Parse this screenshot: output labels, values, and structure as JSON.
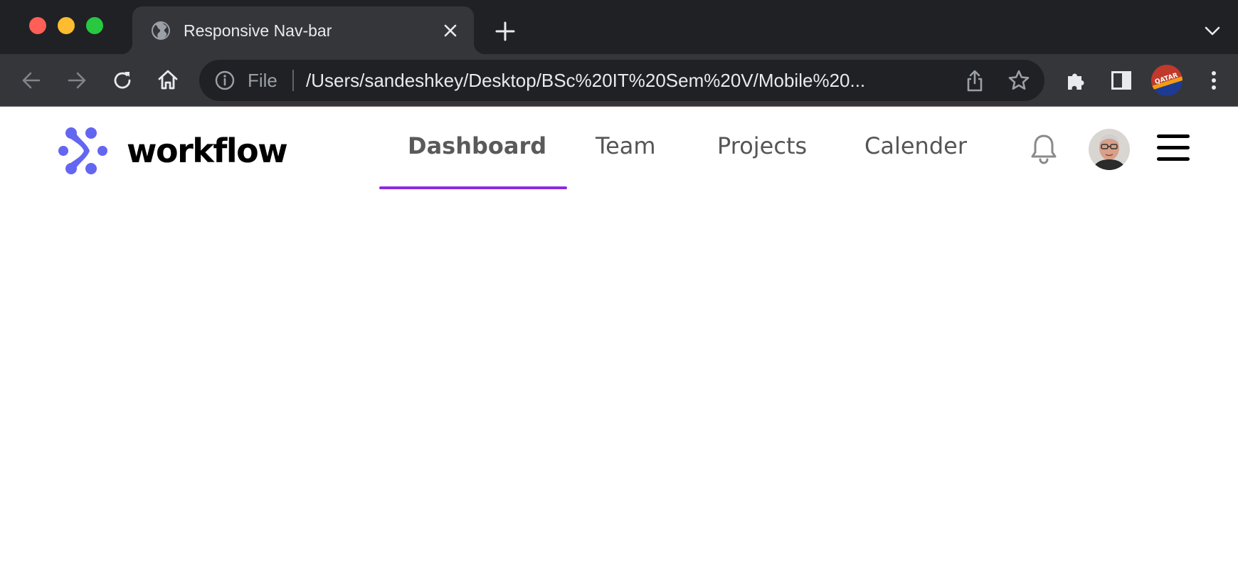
{
  "browser": {
    "tab": {
      "title": "Responsive Nav-bar"
    },
    "address_bar": {
      "scheme_label": "File",
      "url": "/Users/sandeshkey/Desktop/BSc%20IT%20Sem%20V/Mobile%20..."
    }
  },
  "page": {
    "brand": {
      "name": "workflow",
      "logo_color": "#6366f1"
    },
    "nav": {
      "items": [
        {
          "label": "Dashboard",
          "active": true
        },
        {
          "label": "Team",
          "active": false
        },
        {
          "label": "Projects",
          "active": false
        },
        {
          "label": "Calender",
          "active": false
        }
      ],
      "active_indicator_color": "#8a2be2"
    },
    "icons": {
      "notifications": "bell-icon",
      "menu": "hamburger-menu-icon"
    }
  }
}
